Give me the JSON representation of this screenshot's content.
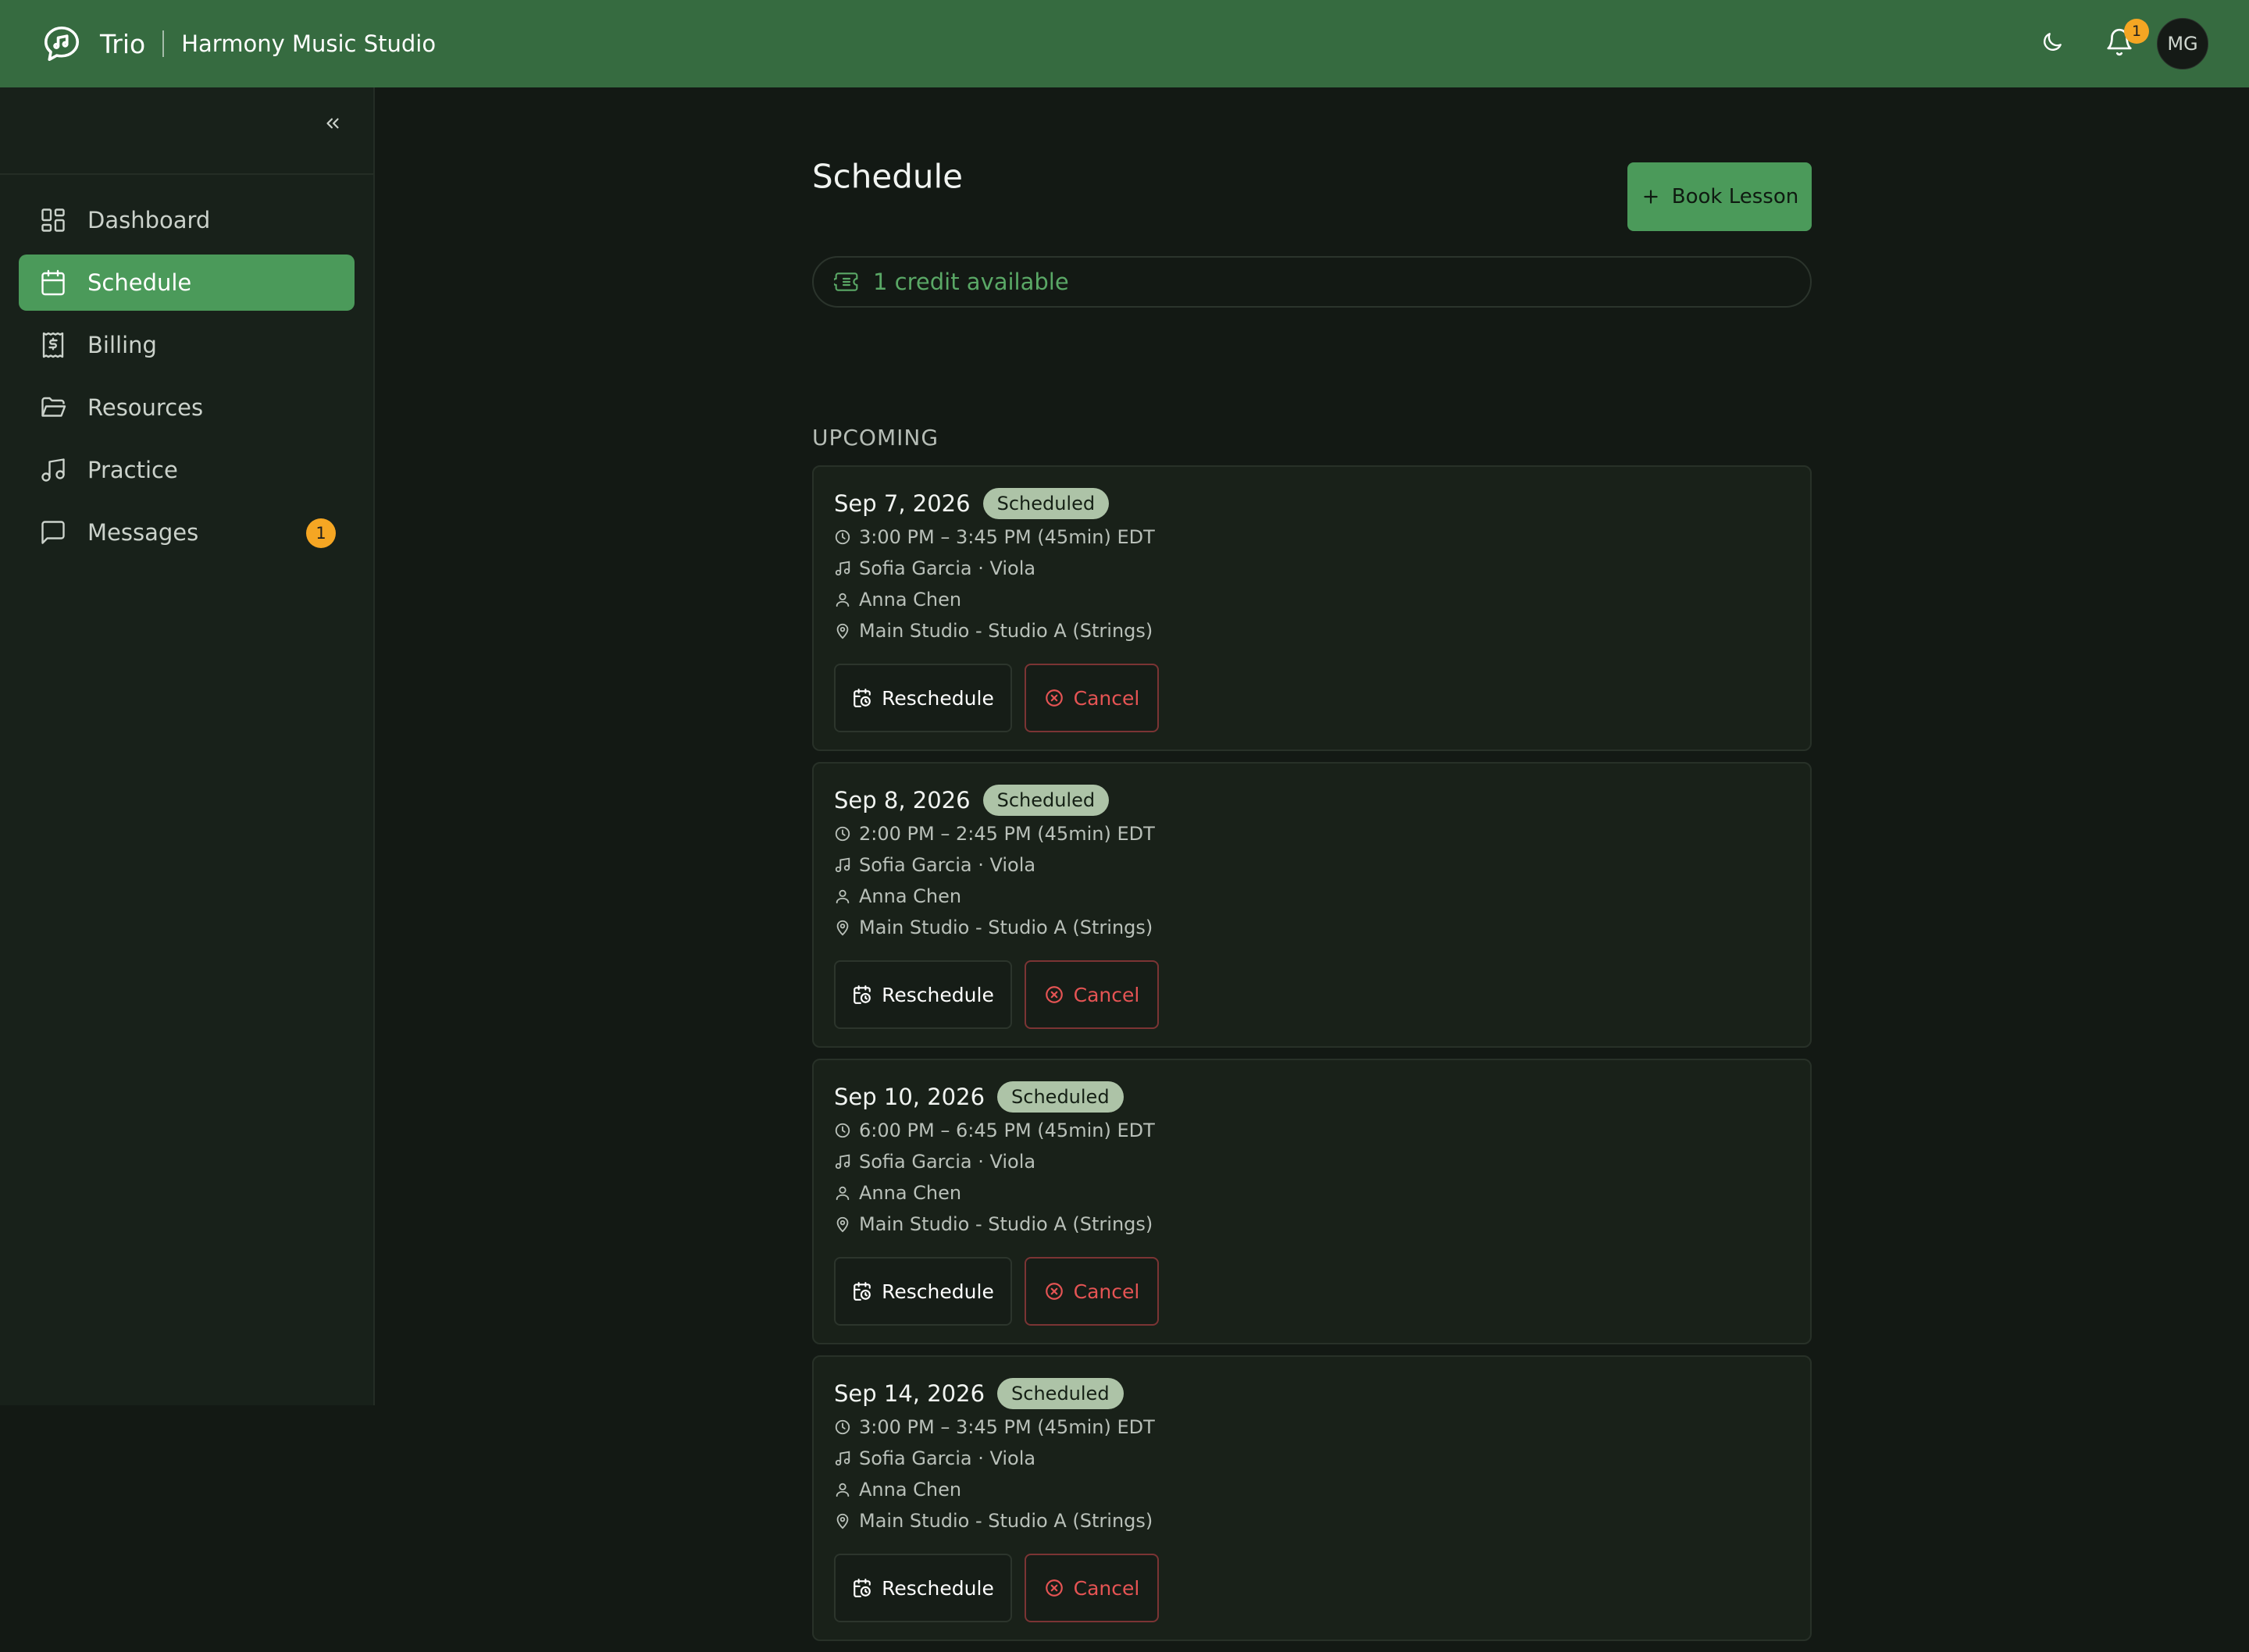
{
  "header": {
    "app_name": "Trio",
    "studio_name": "Harmony Music Studio",
    "notification_count": "1",
    "avatar_initials": "MG",
    "colors": {
      "bar": "#366b40",
      "badge": "#f5a623"
    }
  },
  "sidebar": {
    "items": [
      {
        "label": "Dashboard",
        "icon": "dashboard-icon",
        "active": false
      },
      {
        "label": "Schedule",
        "icon": "calendar-icon",
        "active": true
      },
      {
        "label": "Billing",
        "icon": "receipt-icon",
        "active": false
      },
      {
        "label": "Resources",
        "icon": "folder-icon",
        "active": false
      },
      {
        "label": "Practice",
        "icon": "music-note-icon",
        "active": false
      },
      {
        "label": "Messages",
        "icon": "message-icon",
        "active": false,
        "badge": "1"
      }
    ]
  },
  "main": {
    "title": "Schedule",
    "book_button": "Book Lesson",
    "credits_text": "1 credit available",
    "section_label": "UPCOMING",
    "lessons": [
      {
        "date": "Sep 7, 2026",
        "status": "Scheduled",
        "time": "3:00 PM – 3:45 PM (45min) EDT",
        "instrument": "Sofia Garcia · Viola",
        "teacher": "Anna Chen",
        "location": "Main Studio - Studio A (Strings)",
        "reschedule": "Reschedule",
        "cancel": "Cancel"
      },
      {
        "date": "Sep 8, 2026",
        "status": "Scheduled",
        "time": "2:00 PM – 2:45 PM (45min) EDT",
        "instrument": "Sofia Garcia · Viola",
        "teacher": "Anna Chen",
        "location": "Main Studio - Studio A (Strings)",
        "reschedule": "Reschedule",
        "cancel": "Cancel"
      },
      {
        "date": "Sep 10, 2026",
        "status": "Scheduled",
        "time": "6:00 PM – 6:45 PM (45min) EDT",
        "instrument": "Sofia Garcia · Viola",
        "teacher": "Anna Chen",
        "location": "Main Studio - Studio A (Strings)",
        "reschedule": "Reschedule",
        "cancel": "Cancel"
      },
      {
        "date": "Sep 14, 2026",
        "status": "Scheduled",
        "time": "3:00 PM – 3:45 PM (45min) EDT",
        "instrument": "Sofia Garcia · Viola",
        "teacher": "Anna Chen",
        "location": "Main Studio - Studio A (Strings)",
        "reschedule": "Reschedule",
        "cancel": "Cancel"
      }
    ]
  }
}
